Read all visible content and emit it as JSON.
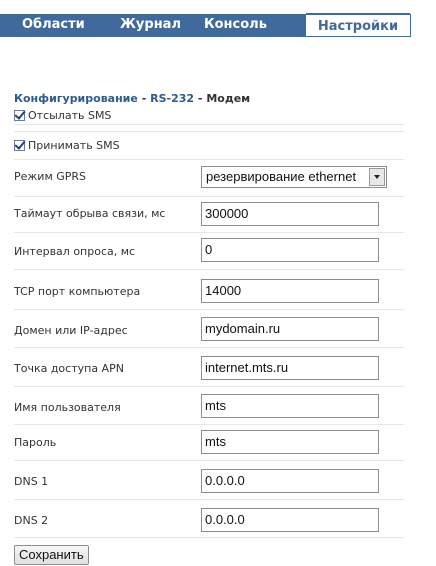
{
  "tabs": [
    {
      "label": "Области"
    },
    {
      "label": "Журнал"
    },
    {
      "label": "Консоль"
    },
    {
      "label": "Настройки",
      "active": true
    }
  ],
  "breadcrumb": {
    "section": "Конфигурирование",
    "separator": "-",
    "port": "RS-232",
    "current": "Модем"
  },
  "checkboxes": {
    "send_sms": {
      "label": "Отсылать SMS",
      "checked": true
    },
    "receive_sms": {
      "label": "Принимать SMS",
      "checked": true
    }
  },
  "fields": {
    "gprs_mode": {
      "label": "Режим GPRS",
      "value": "резервирование ethernet"
    },
    "timeout": {
      "label": "Таймаут обрыва связи, мс",
      "value": "300000"
    },
    "poll_interval": {
      "label": "Интервал опроса, мс",
      "value": "0"
    },
    "tcp_port": {
      "label": "TCP порт компьютера",
      "value": "14000"
    },
    "domain": {
      "label": "Домен или IP-адрес",
      "value": "mydomain.ru"
    },
    "apn": {
      "label": "Точка доступа APN",
      "value": "internet.mts.ru"
    },
    "username": {
      "label": "Имя пользователя",
      "value": "mts"
    },
    "password": {
      "label": "Пароль",
      "value": "mts"
    },
    "dns1": {
      "label": "DNS 1",
      "value": "0.0.0.0"
    },
    "dns2": {
      "label": "DNS 2",
      "value": "0.0.0.0"
    }
  },
  "actions": {
    "save_label": "Сохранить"
  },
  "colors": {
    "tab_bar": "#3f6a9b",
    "link": "#2f5a8f"
  }
}
